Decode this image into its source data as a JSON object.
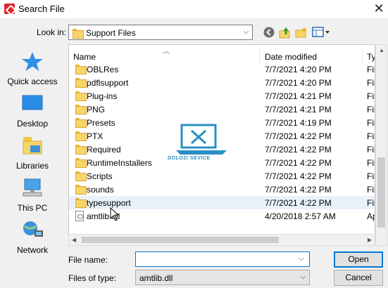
{
  "window": {
    "title": "Search File",
    "close_glyph": "✕"
  },
  "lookin": {
    "label": "Look in:",
    "value": "Support Files",
    "icon": "folder-icon"
  },
  "toolbar": {
    "back_icon": "back-icon",
    "up_icon": "up-folder-icon",
    "new_icon": "new-folder-icon",
    "view_icon": "view-menu-icon"
  },
  "places": [
    {
      "label": "Quick access",
      "icon": "star-icon"
    },
    {
      "label": "Desktop",
      "icon": "desktop-icon"
    },
    {
      "label": "Libraries",
      "icon": "libraries-icon"
    },
    {
      "label": "This PC",
      "icon": "computer-icon"
    },
    {
      "label": "Network",
      "icon": "network-icon"
    }
  ],
  "columns": {
    "name": "Name",
    "date": "Date modified",
    "type": "Ty"
  },
  "files": [
    {
      "name": "OBLRes",
      "date": "7/7/2021 4:20 PM",
      "type": "Fil",
      "kind": "folder"
    },
    {
      "name": "pdflsupport",
      "date": "7/7/2021 4:20 PM",
      "type": "Fil",
      "kind": "folder"
    },
    {
      "name": "Plug-ins",
      "date": "7/7/2021 4:21 PM",
      "type": "Fil",
      "kind": "folder"
    },
    {
      "name": "PNG",
      "date": "7/7/2021 4:21 PM",
      "type": "Fil",
      "kind": "folder"
    },
    {
      "name": "Presets",
      "date": "7/7/2021 4:19 PM",
      "type": "Fil",
      "kind": "folder"
    },
    {
      "name": "PTX",
      "date": "7/7/2021 4:22 PM",
      "type": "Fil",
      "kind": "folder"
    },
    {
      "name": "Required",
      "date": "7/7/2021 4:22 PM",
      "type": "Fil",
      "kind": "folder"
    },
    {
      "name": "RuntimeInstallers",
      "date": "7/7/2021 4:22 PM",
      "type": "Fil",
      "kind": "folder"
    },
    {
      "name": "Scripts",
      "date": "7/7/2021 4:22 PM",
      "type": "Fil",
      "kind": "folder"
    },
    {
      "name": "sounds",
      "date": "7/7/2021 4:22 PM",
      "type": "Fil",
      "kind": "folder"
    },
    {
      "name": "typesupport",
      "date": "7/7/2021 4:22 PM",
      "type": "Fil",
      "kind": "folder",
      "hovered": true
    },
    {
      "name": "amtlib.dll",
      "date": "4/20/2018 2:57 AM",
      "type": "Ap",
      "kind": "file"
    }
  ],
  "watermark": {
    "text": "DOLOZI SEVICE"
  },
  "filename": {
    "label": "File name:",
    "value": ""
  },
  "filetype": {
    "label": "Files of type:",
    "value": "amtlib.dll"
  },
  "buttons": {
    "open": "Open",
    "cancel": "Cancel"
  }
}
